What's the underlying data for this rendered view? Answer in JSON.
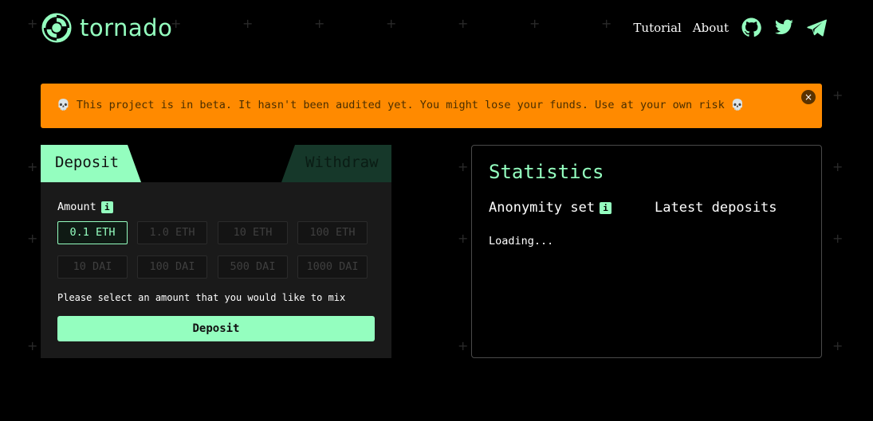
{
  "header": {
    "brand": "tornado",
    "nav": {
      "tutorial": "Tutorial",
      "about": "About"
    },
    "social_icons": [
      "github-icon",
      "twitter-icon",
      "telegram-icon"
    ]
  },
  "banner": {
    "message": "💀 This project is in beta. It hasn't been audited yet. You might lose your funds. Use at your own risk 💀",
    "close_label": "×"
  },
  "deposit_card": {
    "tabs": {
      "deposit": "Deposit",
      "withdraw": "Withdraw"
    },
    "amount_label": "Amount",
    "info_label": "i",
    "amounts": [
      "0.1 ETH",
      "1.0 ETH",
      "10 ETH",
      "100 ETH",
      "10 DAI",
      "100 DAI",
      "500 DAI",
      "1000 DAI"
    ],
    "selected_amount": "0.1 ETH",
    "hint": "Please select an amount that you would like to mix",
    "button_label": "Deposit"
  },
  "statistics": {
    "title": "Statistics",
    "anonymity_set": "Anonymity set",
    "info_label": "i",
    "latest_deposits": "Latest deposits",
    "loading": "Loading..."
  },
  "colors": {
    "accent": "#94febf",
    "warning": "#ff8a00",
    "background": "#000000",
    "card": "#1a1a1a"
  }
}
